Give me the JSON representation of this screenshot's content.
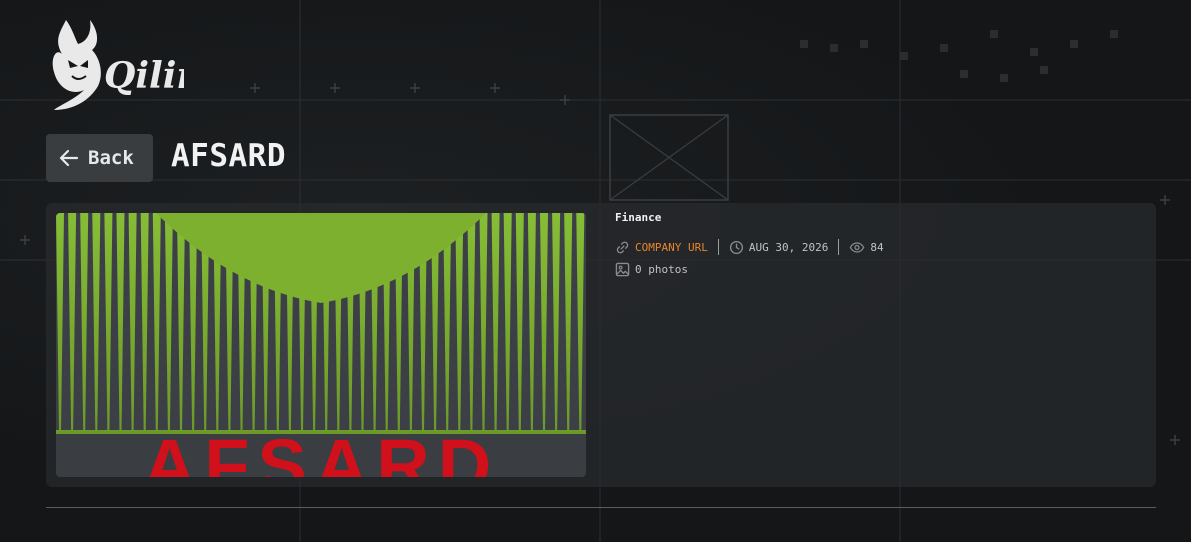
{
  "brand": {
    "logo_text": "Qilin"
  },
  "header": {
    "back_label": "Back",
    "title": "AFSARD"
  },
  "company": {
    "category": "Finance",
    "url_label": "COMPANY URL",
    "date": "AUG 30, 2026",
    "views": "84",
    "photos": "0 photos",
    "image_text": "AFSARD"
  },
  "icons": {
    "back": "arrow-left-icon",
    "link": "link-icon",
    "clock": "clock-icon",
    "views": "eye-icon",
    "photos": "image-icon"
  },
  "colors": {
    "accent_url": "#e8862c",
    "image_green": "#7db02e",
    "image_red": "#d0101a"
  }
}
